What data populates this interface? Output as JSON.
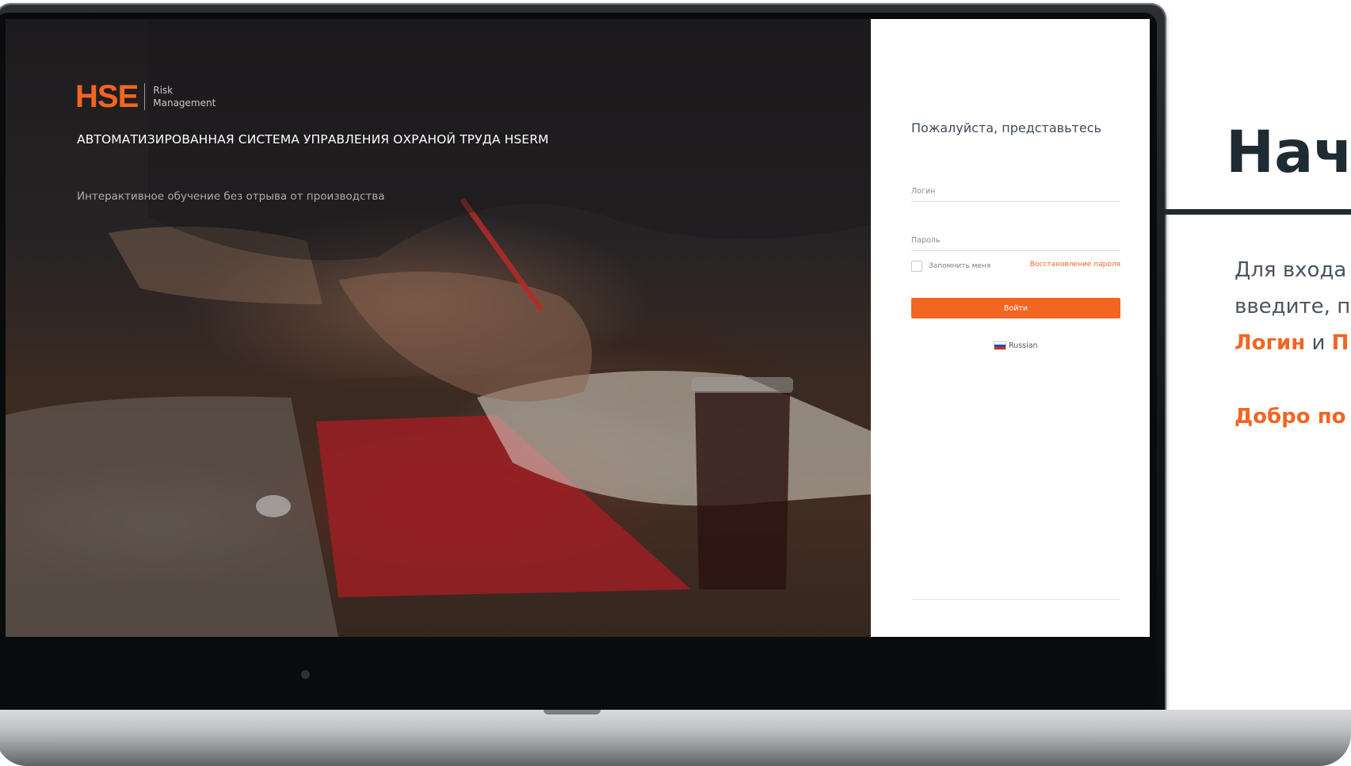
{
  "brand": {
    "logo_text": "HSE",
    "sub_line1": "Risk",
    "sub_line2": "Management"
  },
  "hero": {
    "title": "АВТОМАТИЗИРОВАННАЯ СИСТЕМА УПРАВЛЕНИЯ ОХРАНОЙ ТРУДА HSERM",
    "tagline": "Интерактивное обучение без отрыва от производства"
  },
  "login_form": {
    "heading": "Пожалуйста, представьтесь",
    "login_placeholder": "Логин",
    "password_placeholder": "Пароль",
    "remember_label": "Запомнить меня",
    "recover_link": "Восстановление пароля",
    "submit_label": "Войти",
    "language": "Russian"
  },
  "slide": {
    "title": "Нач",
    "line1": "Для входа",
    "line2": "введите, п",
    "login_word": "Логин",
    "and_word": " и ",
    "password_fragment": "П",
    "welcome": "Добро по"
  },
  "colors": {
    "accent": "#f26522",
    "dark": "#1f2b32"
  }
}
